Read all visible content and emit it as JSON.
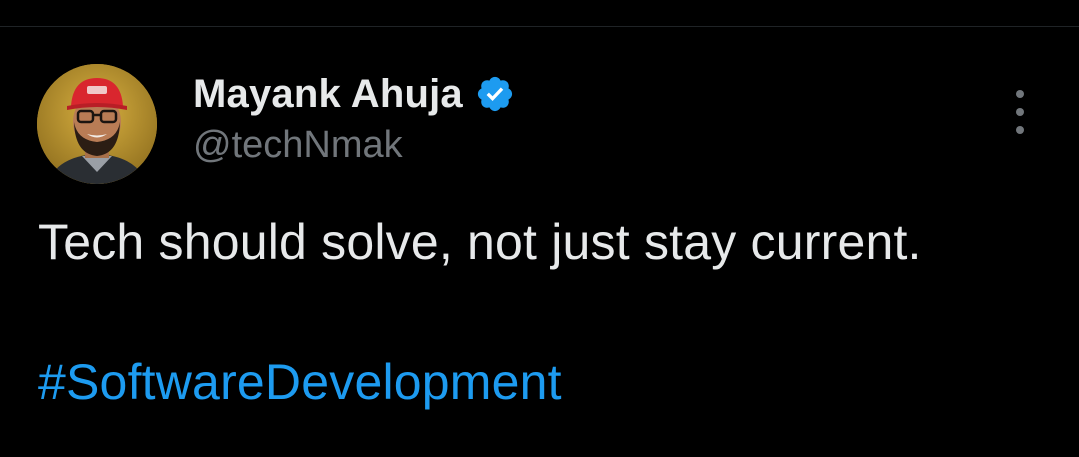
{
  "author": {
    "display_name": "Mayank Ahuja",
    "handle": "@techNmak",
    "verified_icon": "verified-badge-icon",
    "avatar_icon": "avatar"
  },
  "tweet": {
    "text": "Tech should solve, not just stay current.",
    "hashtag": "#SoftwareDevelopment"
  },
  "menu": {
    "icon": "more-vertical-icon"
  },
  "colors": {
    "background": "#000000",
    "primary_text": "#e7e9ea",
    "secondary_text": "#71767b",
    "link": "#1d9bf0",
    "verified": "#1d9bf0"
  }
}
